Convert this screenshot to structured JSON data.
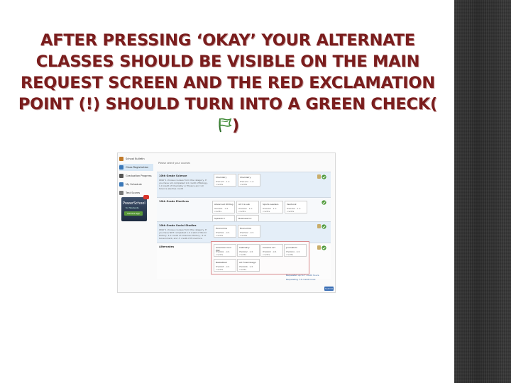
{
  "slide": {
    "title": "AFTER PRESSING ‘OKAY’ YOUR ALTERNATE CLASSES SHOULD BE VISIBLE ON THE MAIN REQUEST SCREEN AND THE RED EXCLAMATION POINT (!) SHOULD TURN INTO A GREEN CHECK(",
    "title_suffix": ")"
  },
  "screenshot": {
    "sidebar": {
      "items": [
        {
          "label": "School Bulletin",
          "icon": "bulletin-icon",
          "color": "#c07a2a"
        },
        {
          "label": "Class Registration",
          "icon": "registration-icon",
          "color": "#3a78b8"
        },
        {
          "label": "Graduation Progress",
          "icon": "graduation-icon",
          "color": "#555555"
        },
        {
          "label": "My Schedule",
          "icon": "calendar-icon",
          "color": "#3a78b8"
        },
        {
          "label": "Test Scores",
          "icon": "tests-icon",
          "color": "#777777"
        }
      ],
      "promo": {
        "title": "PowerSchool",
        "subtitle": "for Students",
        "button": "Get the app",
        "badge_color": "#d9342b"
      }
    },
    "main": {
      "header": "Please select your courses",
      "rows": [
        {
          "name": "10th Grade Science",
          "note": "ONLY 1 choose courses from this category. If you have not completed 1.0 credit of Biology, 1.0 credit of Chemistry or Physics and 1.0 Science elective credit",
          "cells": [
            {
              "title": "Chemistry",
              "sub": "HS0123 · 1.0 credits"
            },
            {
              "title": "Chemistry",
              "sub": "HS0124 · 1.0 credits"
            }
          ],
          "status": "check"
        },
        {
          "name": "10th Grade Electives",
          "note": "",
          "cells": [
            {
              "title": "Advanced Writing",
              "sub": "HS0401 · 0.5 credits"
            },
            {
              "title": "Art I & Lab",
              "sub": "HS0402 · 1.0 credits"
            },
            {
              "title": "Sports Leaders",
              "sub": "HS0403 · 1.0 credits"
            },
            {
              "title": "Yearbook",
              "sub": "HS0404 · 1.0 credits"
            },
            {
              "title": "Spanish II",
              "sub": "HS0405 · 1.0 credits"
            },
            {
              "title": "Business Inc",
              "sub": "HS0406 · 1.0 credits"
            }
          ],
          "status": "check"
        },
        {
          "name": "10th Grade Social Studies",
          "note": "ONLY 1 choose courses from this category. If you have NOT completed 1.0 credit of World History, 1.0 credit of American History, .5 of Government, and .5 credit of Economics.",
          "cells": [
            {
              "title": "Economics",
              "sub": "HS0501 · 0.5 credits"
            },
            {
              "title": "Economics",
              "sub": "HS0502 · 0.5 credits"
            }
          ],
          "status": "check"
        },
        {
          "name": "Alternates",
          "note": "",
          "cells": [
            {
              "title": "American Civil War",
              "sub": "HS0601 · 0.5 credits"
            },
            {
              "title": "Cabinetry",
              "sub": "HS0602 · 0.5 credits"
            },
            {
              "title": "Ceramic Art",
              "sub": "HS0603 · 0.5 credits"
            },
            {
              "title": "Journalism",
              "sub": "HS0604 · 0.5 credits"
            },
            {
              "title": "Basketball",
              "sub": "HS0605 · 0.5 credits"
            },
            {
              "title": "Art Final Design",
              "sub": "HS0606 · 0.5 credits"
            }
          ],
          "status": "check"
        }
      ],
      "footer_line1": "Requested up to 7 credit hours",
      "footer_line2": "Requesting 7.5 credit hours",
      "submit": "Submit"
    },
    "colors": {
      "check": "#4f9a3a",
      "alt_border": "#d9898c",
      "row_blue": "#e4eef8"
    }
  }
}
